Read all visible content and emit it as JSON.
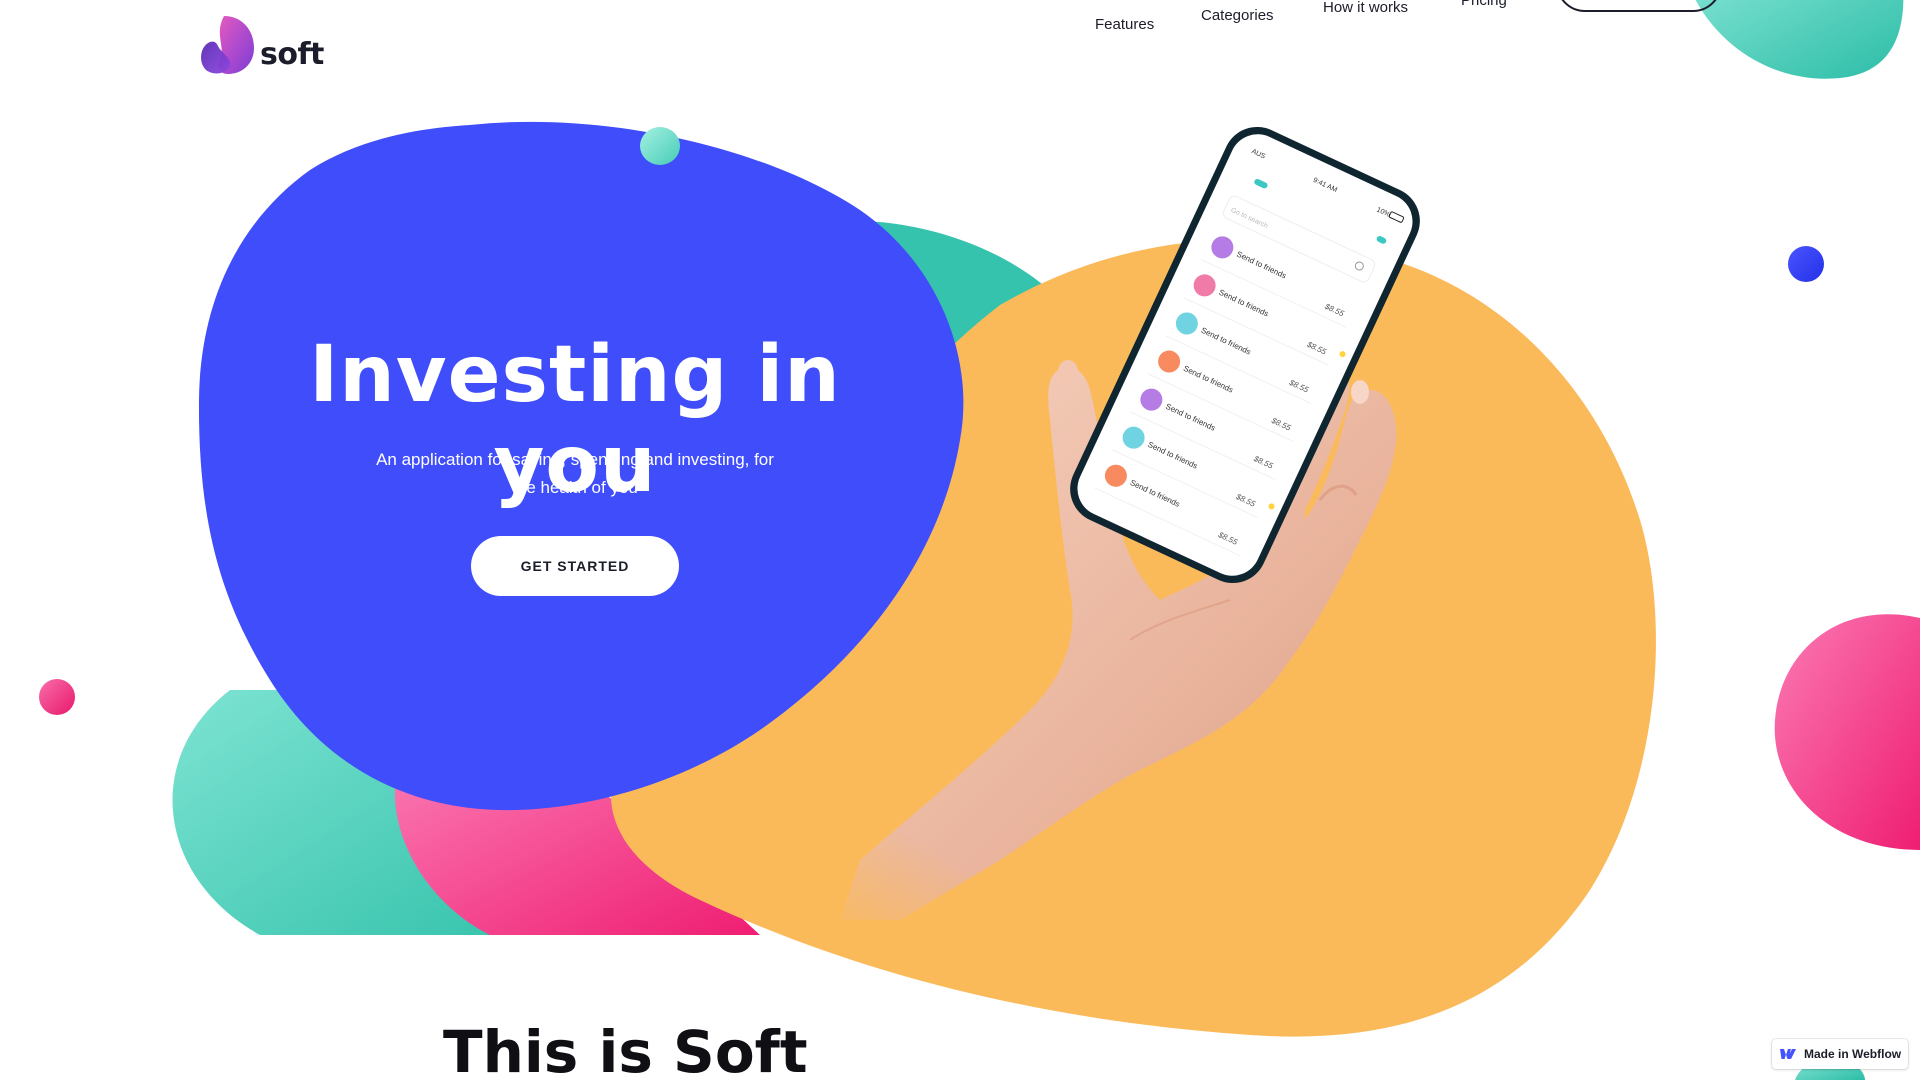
{
  "brand": {
    "name": "soft"
  },
  "nav": {
    "features": "Features",
    "categories": "Categories",
    "how_it_works": "How it works",
    "pricing": "Pricing"
  },
  "hero": {
    "title": "Investing in you",
    "subtitle_line1": "An application for saving, spending and investing, for",
    "subtitle_line2": "the health of you",
    "cta": "GET STARTED"
  },
  "phone": {
    "carrier": "AUS",
    "time": "9:41 AM",
    "battery": "10%",
    "search_placeholder": "Go to search",
    "transactions": [
      {
        "title": "Send to friends",
        "amount": "$8.55"
      },
      {
        "title": "Send to friends",
        "amount": "$8.55"
      },
      {
        "title": "Send to friends",
        "amount": "$8.55"
      },
      {
        "title": "Send to friends",
        "amount": "$8.55"
      },
      {
        "title": "Send to friends",
        "amount": "$8.55"
      },
      {
        "title": "Send to friends",
        "amount": "$8.55"
      },
      {
        "title": "Send to friends",
        "amount": "$8.55"
      }
    ]
  },
  "section": {
    "title": "This is Soft"
  },
  "badge": {
    "text": "Made in Webflow"
  },
  "colors": {
    "blue": "#3f4dfb",
    "orange": "#fbba5a",
    "teal": "#39c4ae",
    "pink": "#f01f78",
    "dark": "#1b1d2a"
  }
}
